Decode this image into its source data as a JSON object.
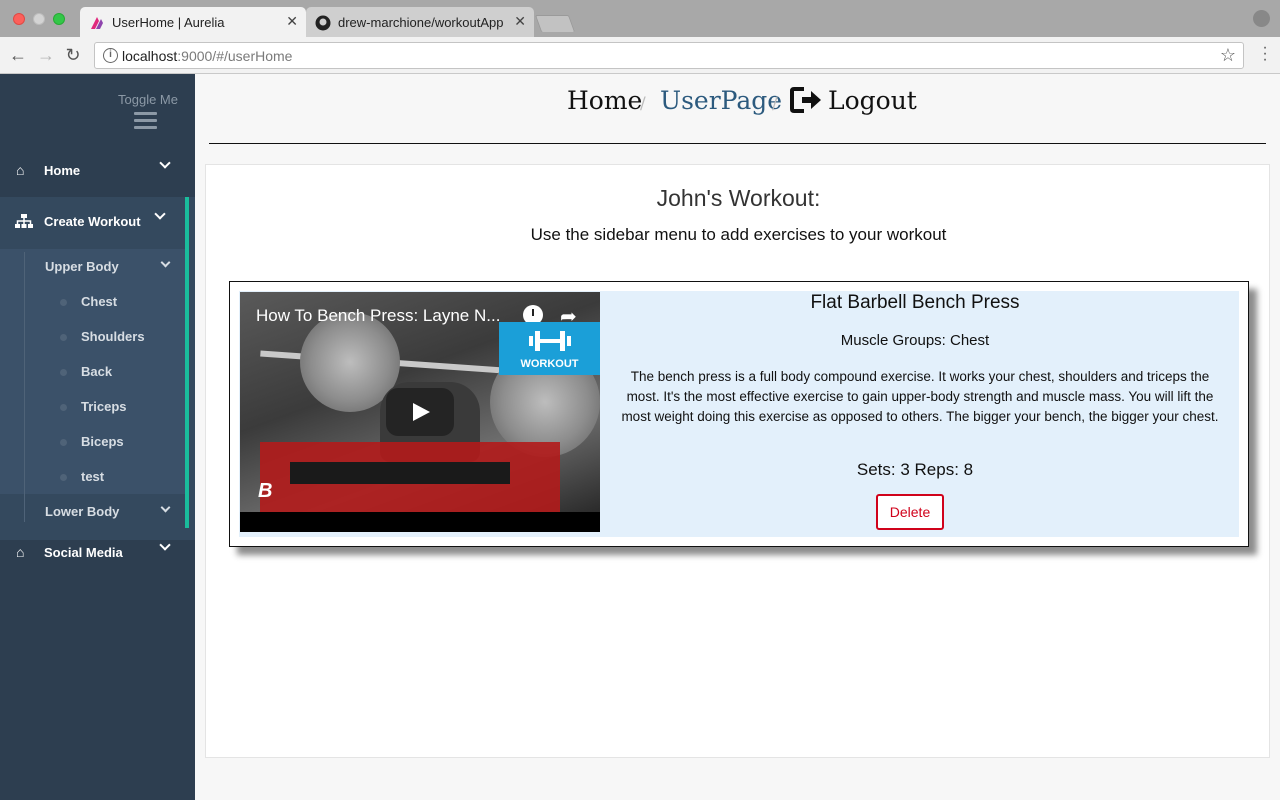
{
  "browser": {
    "tabs": [
      {
        "title": "UserHome | Aurelia",
        "active": true
      },
      {
        "title": "drew-marchione/workoutApp",
        "active": false
      }
    ],
    "url_host": "localhost",
    "url_path": ":9000/#/userHome"
  },
  "sidebar": {
    "toggle_label": "Toggle Me",
    "items": [
      {
        "label": "Home",
        "icon": "home-icon"
      },
      {
        "label": "Create Workout",
        "icon": "sitemap-icon"
      },
      {
        "label": "Social Media",
        "icon": "home-icon"
      }
    ],
    "groups": [
      {
        "label": "Upper Body",
        "children": [
          "Chest",
          "Shoulders",
          "Back",
          "Triceps",
          "Biceps",
          "test"
        ]
      },
      {
        "label": "Lower Body",
        "children": []
      }
    ],
    "accent_color": "#1abc9c"
  },
  "breadcrumb": {
    "home": "Home",
    "separator": "/",
    "user": "UserPage",
    "logout": "Logout"
  },
  "main": {
    "title": "John's Workout:",
    "subtitle": "Use the sidebar menu to add exercises to your workout"
  },
  "exercise": {
    "video_title": "How To Bench Press: Layne N...",
    "video_badge": "WORKOUT",
    "name": "Flat Barbell Bench Press",
    "muscles": "Muscle Groups: Chest",
    "description": "The bench press is a full body compound exercise. It works your chest, shoulders and triceps the most. It's the most effective exercise to gain upper-body strength and muscle mass. You will lift the most weight doing this exercise as opposed to others. The bigger your bench, the bigger your chest.",
    "sets_reps": "Sets: 3 Reps: 8",
    "delete_label": "Delete"
  }
}
